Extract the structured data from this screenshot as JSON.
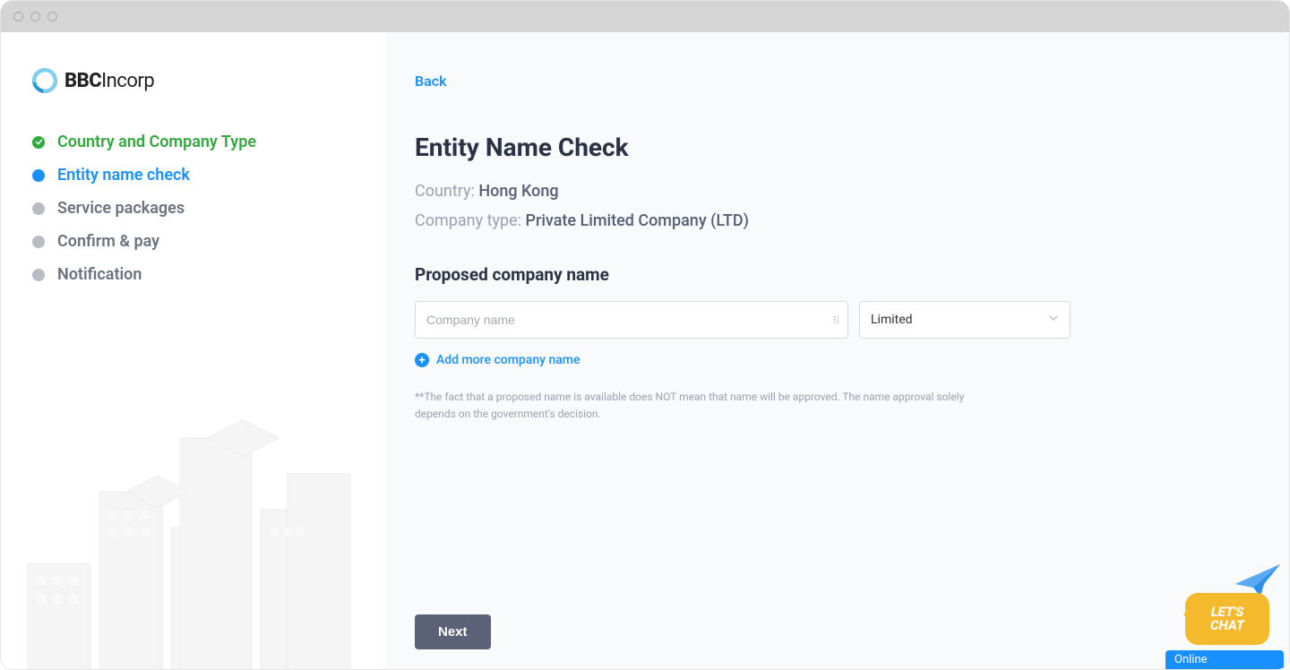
{
  "brand": {
    "bold": "BBC",
    "rest": "Incorp"
  },
  "sidebar": {
    "steps": [
      {
        "label": "Country and Company Type",
        "state": "completed"
      },
      {
        "label": "Entity name check",
        "state": "active"
      },
      {
        "label": "Service packages",
        "state": "pending"
      },
      {
        "label": "Confirm & pay",
        "state": "pending"
      },
      {
        "label": "Notification",
        "state": "pending"
      }
    ]
  },
  "main": {
    "back_label": "Back",
    "title": "Entity Name Check",
    "country_label": "Country: ",
    "country_value": "Hong Kong",
    "company_type_label": "Company type: ",
    "company_type_value": "Private Limited Company (LTD)",
    "section_heading": "Proposed company name",
    "company_name_placeholder": "Company name",
    "company_name_value": "",
    "suffix_selected": "Limited",
    "add_more_label": "Add more company name",
    "disclaimer": "**The fact that a proposed name is available does NOT mean that name will be approved. The name approval solely depends on the government's decision.",
    "next_label": "Next"
  },
  "chat": {
    "bubble_line1": "LET'S",
    "bubble_line2": "CHAT",
    "status": "Online"
  }
}
